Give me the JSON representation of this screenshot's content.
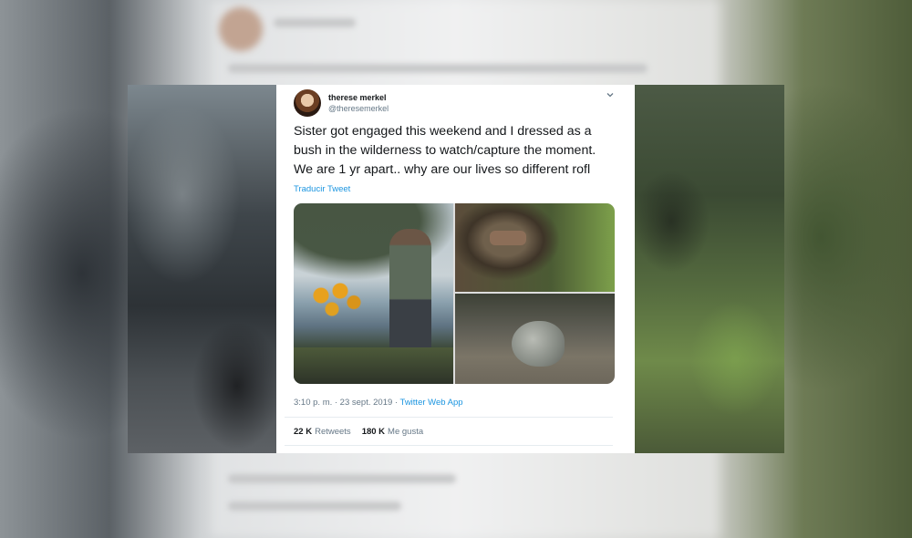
{
  "tweet": {
    "display_name": "therese merkel",
    "handle": "@theresemerkel",
    "text": "Sister got engaged this weekend and I dressed as a bush in the wilderness to watch/capture the moment. We are 1 yr apart.. why are our lives so different rofl",
    "translate_label": "Traducir Tweet",
    "timestamp": "3:10 p. m. · 23 sept. 2019 · ",
    "source": "Twitter Web App",
    "retweets_count": "22 K",
    "retweets_label": "Retweets",
    "likes_count": "180 K",
    "likes_label": "Me gusta",
    "menu_icon": "chevron-down-icon",
    "link_color": "#1b95e0"
  }
}
